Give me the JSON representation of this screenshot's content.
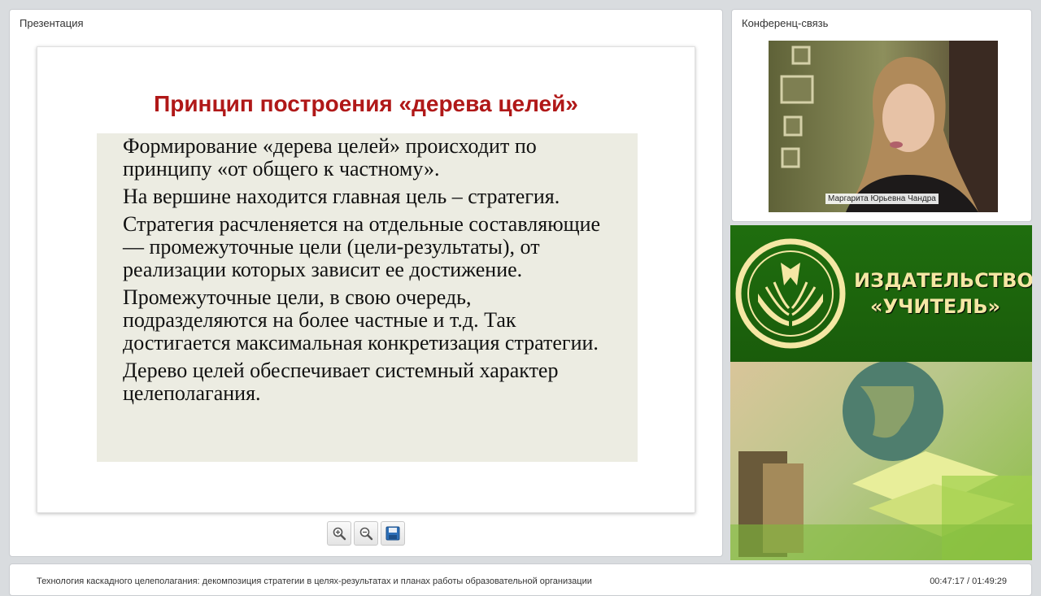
{
  "presentation": {
    "panel_title": "Презентация",
    "slide_title": "Принцип построения «дерева целей»",
    "paragraphs": [
      "Формирование «дерева целей» происходит по принципу «от общего к частному».",
      "На вершине находится главная цель – стратегия.",
      "Стратегия расчленяется на отдельные составляющие — промежуточные цели (цели-результаты), от реализации которых зависит ее достижение.",
      "Промежуточные цели, в свою очередь, подразделяются на более частные и т.д. Так достигается максимальная конкретизация стратегии.",
      "Дерево целей обеспечивает системный характер целеполагания."
    ],
    "toolbar": {
      "zoom_in_icon": "zoom-in-icon",
      "zoom_out_icon": "zoom-out-icon",
      "save_icon": "save-icon"
    }
  },
  "conference": {
    "panel_title": "Конференц-связь",
    "speaker_name": "Маргарита Юрьевна Чандра"
  },
  "ad": {
    "line1": "ИЗДАТЕЛЬСТВО",
    "line2": "«УЧИТЕЛЬ»"
  },
  "footer": {
    "title": "Технология каскадного целеполагания: декомпозиция стратегии в целях-результатах и планах работы образовательной организации",
    "time": "00:47:17 / 01:49:29"
  },
  "colors": {
    "slide_title": "#b01818",
    "slide_box": "#ecece2",
    "ad_green": "#1f6e0e",
    "ad_text": "#f5e7a4"
  }
}
